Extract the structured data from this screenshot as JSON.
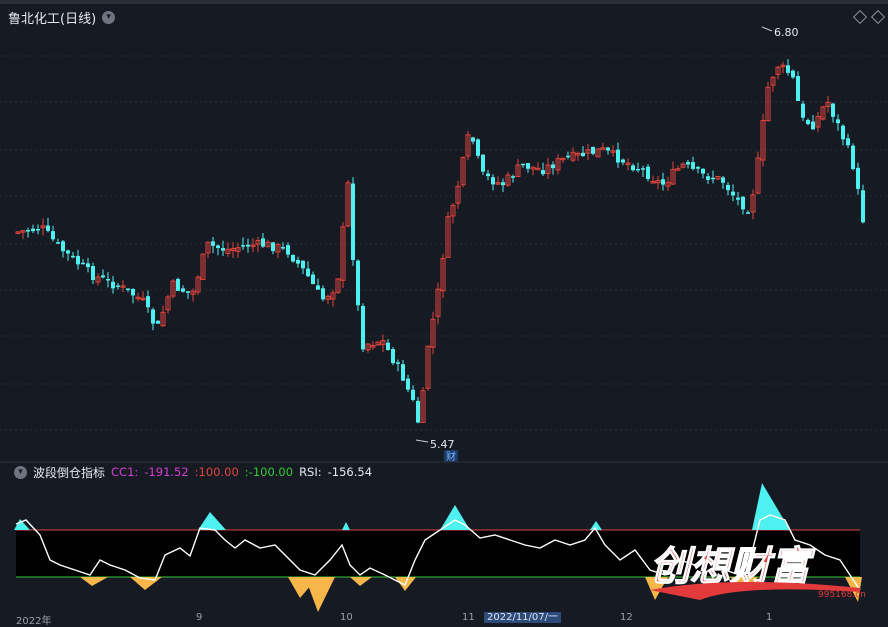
{
  "header": {
    "stock_title": "鲁北化工(日线)",
    "dropdown_icon": "chevron-down-icon"
  },
  "price_chart": {
    "high_label": "6.80",
    "low_label": "5.47",
    "cai_badge": "财",
    "up_color": "#e0443c",
    "down_color": "#4ef0f0"
  },
  "indicator": {
    "name": "波段倒仓指标",
    "cc1_label": "CC1:",
    "cc1_value": "-191.52",
    "upper_value": ":100.00",
    "lower_value": ":-100.00",
    "rsi_label": "RSI:",
    "rsi_value": "-156.54",
    "upper_line_color": "#e0443c",
    "lower_line_color": "#37c837"
  },
  "x_axis": {
    "labels": [
      "2022年",
      "9",
      "10",
      "11",
      "12",
      "1"
    ],
    "highlight": "2022/11/07/一"
  },
  "watermark": {
    "title": "创想财富",
    "url": "995168.cn"
  },
  "chart_data": {
    "type": "candlestick",
    "x_start": "2022年",
    "count": 170,
    "high": 6.8,
    "low": 5.47
  }
}
